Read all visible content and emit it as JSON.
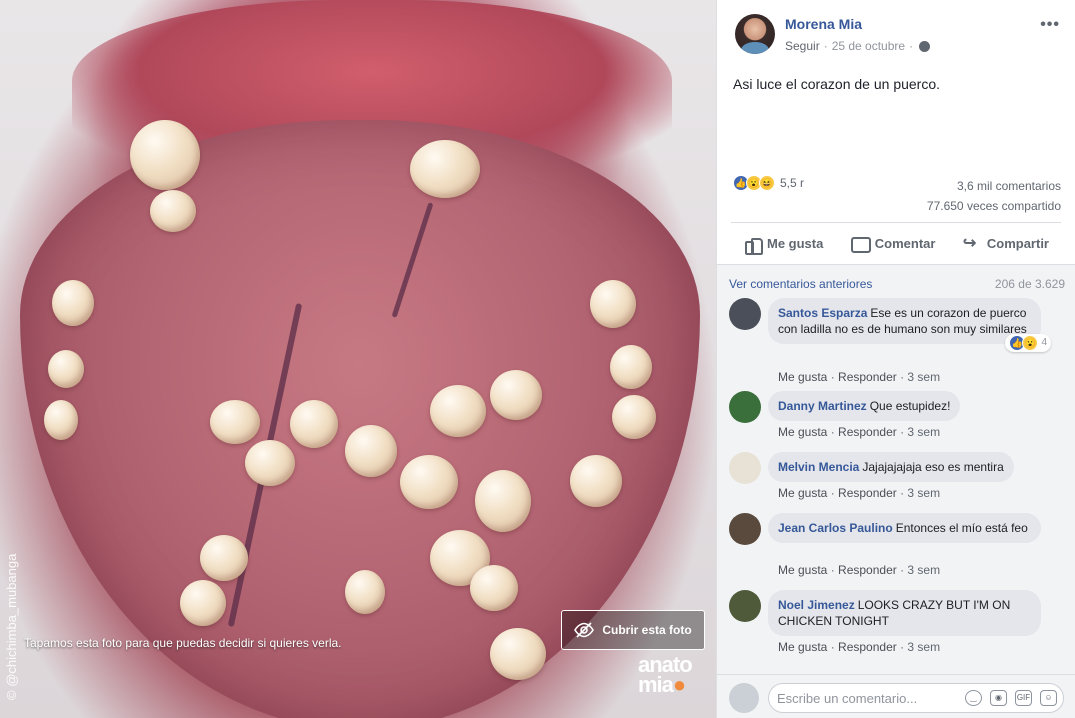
{
  "photo": {
    "watermark_left": "© @chichimba_mubanga",
    "cover_note": "Tapamos esta foto para que puedas decidir si quieres verla.",
    "cover_button": "Cubrir esta foto",
    "logo_line1": "anato",
    "logo_line2": "mia"
  },
  "post": {
    "author": "Morena Mia",
    "follow": "Seguir",
    "date": "25 de octubre",
    "separator": "·",
    "text": "Asi luce el corazon de un puerco.",
    "reactions_count": "5,5 r",
    "comments_count": "3,6 mil comentarios",
    "shares_count": "77.650 veces compartido",
    "icons": [
      "like-icon",
      "wow-icon",
      "haha-icon",
      "globe-icon",
      "more-icon"
    ]
  },
  "actions": {
    "like": "Me gusta",
    "comment": "Comentar",
    "share": "Compartir"
  },
  "comments_header": {
    "previous": "Ver comentarios anteriores",
    "count": "206 de 3.629"
  },
  "comment_actions": {
    "like": "Me gusta",
    "reply": "Responder"
  },
  "comments": [
    {
      "name": "Santos Esparza",
      "text": "Ese es un corazon de puerco con ladilla no es de humano son muy similares",
      "time": "3 sem",
      "reacts": "4",
      "avatar_color": "#4a4f5a"
    },
    {
      "name": "Danny Martinez",
      "text": "Que estupidez!",
      "time": "3 sem",
      "avatar_color": "#3a6e3a"
    },
    {
      "name": "Melvin Mencia",
      "text": "Jajajajajaja eso es mentira",
      "time": "3 sem",
      "avatar_color": "#e8e2d6"
    },
    {
      "name": "Jean Carlos Paulino",
      "text": "Entonces el mío está feo",
      "time": "3 sem",
      "avatar_color": "#5a4a3e"
    },
    {
      "name": "Noel Jimenez",
      "text": "LOOKS CRAZY BUT I'M ON CHICKEN TONIGHT",
      "time": "3 sem",
      "avatar_color": "#4e5a3a"
    }
  ],
  "composer": {
    "placeholder": "Escribe un comentario...",
    "icons": [
      "emoji-icon",
      "camera-icon",
      "gif-icon",
      "sticker-icon"
    ],
    "gif_label": "GIF"
  }
}
